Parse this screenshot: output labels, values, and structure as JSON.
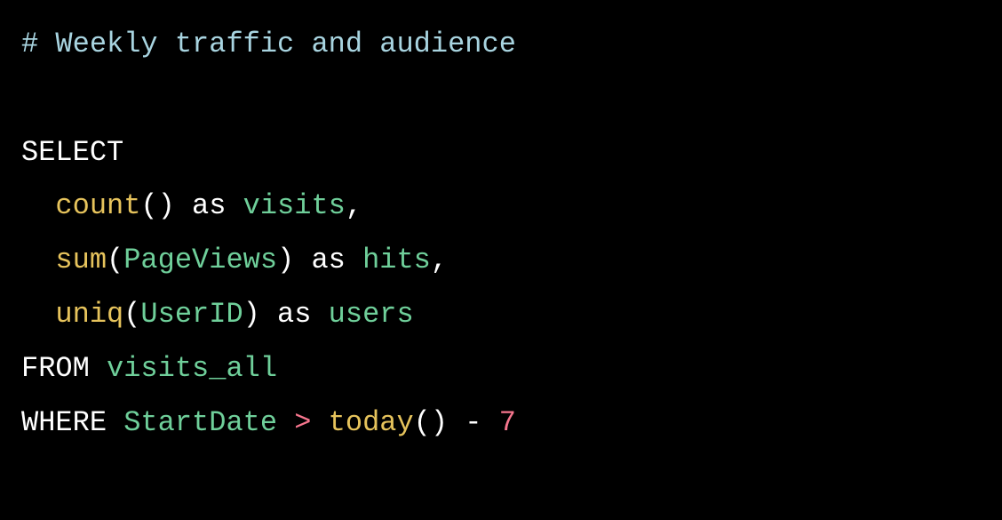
{
  "code": {
    "comment_prefix": "# ",
    "comment_text": "Weekly traffic and audience",
    "select": "SELECT",
    "indent": "  ",
    "count_fn": "count",
    "lparen": "(",
    "rparen": ")",
    "as": " as ",
    "visits": "visits",
    "comma": ",",
    "sum_fn": "sum",
    "pageviews": "PageViews",
    "hits": "hits",
    "uniq_fn": "uniq",
    "userid": "UserID",
    "users": "users",
    "from": "FROM ",
    "visits_all": "visits_all",
    "where": "WHERE ",
    "startdate": "StartDate",
    "gt": " > ",
    "today_fn": "today",
    "minus": " - ",
    "seven": "7"
  }
}
